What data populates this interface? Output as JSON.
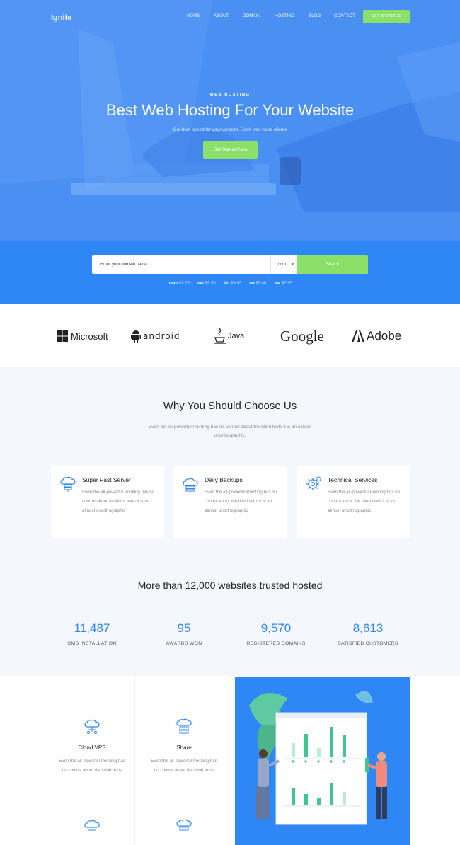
{
  "nav": {
    "brand": "Ignite",
    "items": [
      "HOME",
      "ABOUT",
      "DOMAIN",
      "HOSTING",
      "BLOG",
      "CONTACT"
    ],
    "cta": "GET STARTED"
  },
  "hero": {
    "kicker": "WEB HOSTING",
    "title": "Best Web Hosting For Your Website",
    "subtitle": "Get best speed for your website. Don't lose more clients",
    "button": "Get Started Now"
  },
  "domain_search": {
    "placeholder": "Enter your domain name...",
    "tld_selected": ".com",
    "button": "Search",
    "prices": [
      {
        "tld": ".com",
        "price": "$9.75"
      },
      {
        "tld": ".net",
        "price": "$9.50"
      },
      {
        "tld": ".biz",
        "price": "$8.95"
      },
      {
        "tld": ".co",
        "price": "$7.80"
      },
      {
        "tld": ".me",
        "price": "$7.95"
      }
    ]
  },
  "partners": [
    "Microsoft",
    "android",
    "Java",
    "Google",
    "Adobe"
  ],
  "why": {
    "title": "Why You Should Choose Us",
    "subtitle": "Even the all-powerful Pointing has no control about the blind texts it is an almost unorthographic.",
    "features": [
      {
        "title": "Super Fast Server",
        "text": "Even the all-powerful Pointing has no control about the blind texts it is an almost unorthographic",
        "icon": "server-cloud-icon"
      },
      {
        "title": "Daily Backups",
        "text": "Even the all-powerful Pointing has no control about the blind texts it is an almost unorthographic",
        "icon": "backup-cloud-icon"
      },
      {
        "title": "Technical Services",
        "text": "Even the all-powerful Pointing has no control about the blind texts it is an almost unorthographic",
        "icon": "gear-service-icon"
      }
    ]
  },
  "stats": {
    "title": "More than 12,000 websites trusted hosted",
    "items": [
      {
        "number": "11,487",
        "label": "CMS INSTALLATION"
      },
      {
        "number": "95",
        "label": "AWARDS WON"
      },
      {
        "number": "9,570",
        "label": "REGISTERED DOMAINS"
      },
      {
        "number": "8,613",
        "label": "SATISFIED CUSTOMERS"
      }
    ]
  },
  "services": [
    {
      "title": "Cloud VPS",
      "text": "Even the all-powerful Pointing has no control about the blind texts"
    },
    {
      "title": "Share",
      "text": "Even the all-powerful Pointing has no control about the blind texts"
    }
  ],
  "colors": {
    "primary": "#2f86f5",
    "hero_overlay": "#4a8ff2",
    "accent_green": "#8be06a",
    "section_bg": "#f4f8fc"
  }
}
